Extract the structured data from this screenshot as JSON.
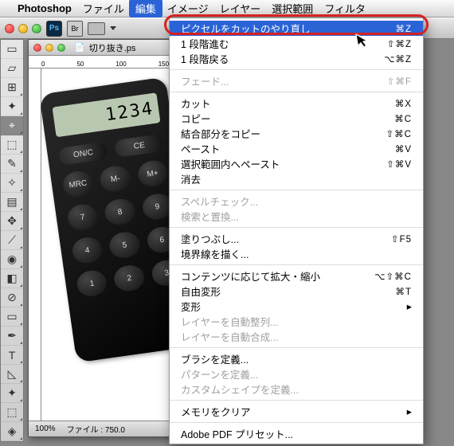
{
  "menubar": {
    "app": "Photoshop",
    "items": [
      "ファイル",
      "編集",
      "イメージ",
      "レイヤー",
      "選択範囲",
      "フィルタ"
    ],
    "active_index": 1
  },
  "optbar": {
    "ps": "Ps",
    "br": "Br"
  },
  "doc": {
    "title": "切り抜き.ps",
    "ruler": [
      "0",
      "50",
      "100",
      "150"
    ],
    "zoom": "100%",
    "filesize": "ファイル : 750.0"
  },
  "calc": {
    "display": "1234",
    "rows": [
      [
        "ON/C",
        "CE"
      ],
      [
        "MRC",
        "M-",
        "M+"
      ],
      [
        "7",
        "8",
        "9"
      ],
      [
        "4",
        "5",
        "6"
      ],
      [
        "1",
        "2",
        "3"
      ]
    ]
  },
  "menu": [
    {
      "label": "ピクセルをカットのやり直し",
      "sc": "⌘Z",
      "hi": true
    },
    {
      "label": "1 段階進む",
      "sc": "⇧⌘Z"
    },
    {
      "label": "1 段階戻る",
      "sc": "⌥⌘Z"
    },
    {
      "sep": true
    },
    {
      "label": "フェード...",
      "sc": "⇧⌘F",
      "dis": true
    },
    {
      "sep": true
    },
    {
      "label": "カット",
      "sc": "⌘X"
    },
    {
      "label": "コピー",
      "sc": "⌘C"
    },
    {
      "label": "結合部分をコピー",
      "sc": "⇧⌘C"
    },
    {
      "label": "ペースト",
      "sc": "⌘V"
    },
    {
      "label": "選択範囲内へペースト",
      "sc": "⇧⌘V"
    },
    {
      "label": "消去"
    },
    {
      "sep": true
    },
    {
      "label": "スペルチェック...",
      "dis": true
    },
    {
      "label": "検索と置換...",
      "dis": true
    },
    {
      "sep": true
    },
    {
      "label": "塗りつぶし...",
      "sc": "⇧F5"
    },
    {
      "label": "境界線を描く..."
    },
    {
      "sep": true
    },
    {
      "label": "コンテンツに応じて拡大・縮小",
      "sc": "⌥⇧⌘C"
    },
    {
      "label": "自由変形",
      "sc": "⌘T"
    },
    {
      "label": "変形",
      "sub": true
    },
    {
      "label": "レイヤーを自動整列...",
      "dis": true
    },
    {
      "label": "レイヤーを自動合成...",
      "dis": true
    },
    {
      "sep": true
    },
    {
      "label": "ブラシを定義..."
    },
    {
      "label": "パターンを定義...",
      "dis": true
    },
    {
      "label": "カスタムシェイプを定義...",
      "dis": true
    },
    {
      "sep": true
    },
    {
      "label": "メモリをクリア",
      "sub": true
    },
    {
      "sep": true
    },
    {
      "label": "Adobe PDF プリセット..."
    }
  ],
  "tools": [
    "▭",
    "▱",
    "⊞",
    "✦",
    "⌖",
    "⬚",
    "✎",
    "✧",
    "▤",
    "✥",
    "⟋",
    "◉",
    "◧",
    "⊘",
    "▭",
    "✒",
    "T",
    "◺",
    "✦",
    "⬚",
    "◈"
  ]
}
